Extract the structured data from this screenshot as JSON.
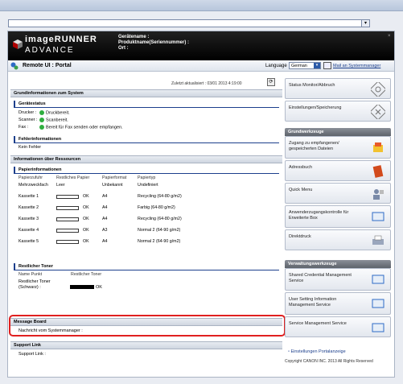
{
  "header": {
    "brand_top": "imageRUNNER",
    "brand_bottom": "ADVANCE",
    "device_name_label": "Gerätename :",
    "product_name_label": "Produktname(Seriennummer) :",
    "location_label": "Ort :"
  },
  "titlebar": {
    "title": "Remote UI : Portal",
    "language_label": "Language",
    "language_value": "German",
    "mail_link": "Mail an Systemmanager"
  },
  "main": {
    "last_updated": "Zuletzt aktualisiert : 03/01 2013 4:19:00",
    "basic_info": {
      "title": "Grundinformationen zum System",
      "device_status_title": "Gerätestatus",
      "status_rows": [
        {
          "label": "Drucker :",
          "value": "Druckbereit."
        },
        {
          "label": "Scanner :",
          "value": "Scanbereit."
        },
        {
          "label": "Fax :",
          "value": "Bereit für Fax senden oder empfangen."
        }
      ],
      "error_title": "Fehlerinformationen",
      "error_value": "Kein Fehler"
    },
    "resources": {
      "title": "Informationen über Ressourcen",
      "paper_title": "Papierinformationen",
      "columns": [
        "Papierzufuhr",
        "Restliches Papier",
        "Papierformat",
        "Papiertyp"
      ],
      "rows": [
        {
          "source": "Mehrzweckfach",
          "remaining": "Leer",
          "size": "Unbekannt",
          "type": "Undefiniert",
          "bar": false
        },
        {
          "source": "Kassette 1",
          "remaining": "OK",
          "size": "A4",
          "type": "Recycling (64-80 g/m2)",
          "bar": true
        },
        {
          "source": "Kassette 2",
          "remaining": "OK",
          "size": "A4",
          "type": "Farbig (64-80 g/m2)",
          "bar": true
        },
        {
          "source": "Kassette 3",
          "remaining": "OK",
          "size": "A4",
          "type": "Recycling (64-80 g/m2)",
          "bar": true
        },
        {
          "source": "Kassette 4",
          "remaining": "OK",
          "size": "A3",
          "type": "Normal 2 (64-90 g/m2)",
          "bar": true
        },
        {
          "source": "Kassette 5",
          "remaining": "OK",
          "size": "A4",
          "type": "Normal 2 (64-90 g/m2)",
          "bar": true
        }
      ],
      "toner_title": "Restlicher Toner",
      "toner_columns": [
        "Name Punkt",
        "Restlicher Toner"
      ],
      "toner_row_label": "Restlicher Toner (Schwarz) :",
      "toner_row_value": "OK"
    },
    "message_board": {
      "title": "Message Board",
      "label": "Nachricht vom Systemmanager :"
    },
    "support": {
      "title": "Support Link",
      "label": "Support Link :"
    }
  },
  "side": {
    "top_buttons": [
      "Status Monitor/Abbruch",
      "Einstellungen/Speicherung"
    ],
    "basic_tools_title": "Grundwerkzeuge",
    "basic_tools": [
      "Zugang zu empfangenen/ gespeicherten Dateien",
      "Adressbuch",
      "Quick Menu",
      "Anwenderzugangskontrolle für Erweiterte Box",
      "Direktdruck"
    ],
    "admin_tools_title": "Verwaltungswerkzeuge",
    "admin_tools": [
      "Shared Credential Management Service",
      "User Setting Information Management Service",
      "Service Management Service"
    ],
    "settings_link": "Einstellungen Portalanzeige",
    "copyright": "Copyright CANON INC. 2013 All Rights Reserved"
  }
}
